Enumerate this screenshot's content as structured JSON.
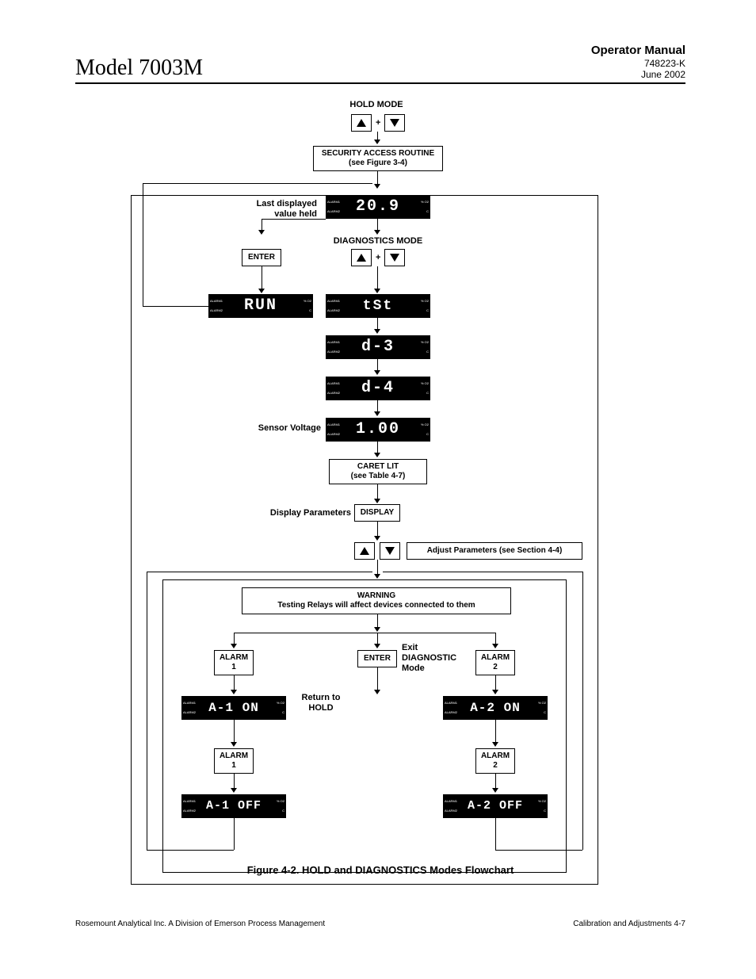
{
  "header": {
    "model": "Model 7003M",
    "manual": "Operator Manual",
    "docnum": "748223-K",
    "date": "June 2002"
  },
  "labels": {
    "hold_mode": "HOLD MODE",
    "security": "SECURITY ACCESS ROUTINE\n(see Figure 3-4)",
    "last_value": "Last displayed\nvalue held",
    "diagnostics_mode": "DIAGNOSTICS MODE",
    "enter": "ENTER",
    "sensor_voltage": "Sensor Voltage",
    "caret_lit": "CARET LIT\n(see Table 4-7)",
    "display_params": "Display Parameters",
    "display": "DISPLAY",
    "adjust_params": "Adjust Parameters (see Section 4-4)",
    "warning": "WARNING\nTesting Relays will affect devices connected to them",
    "alarm1": "ALARM\n1",
    "alarm2": "ALARM\n2",
    "exit_diag": "Exit\nDIAGNOSTIC\nMode",
    "return_hold": "Return to\nHOLD",
    "plus": "+"
  },
  "lcd": {
    "side_left_1": "ALARM1",
    "side_left_2": "ALARM2",
    "side_right_1": "% O2",
    "side_right_2": "C",
    "v_209": "20.9",
    "v_run": "RUN",
    "v_tst": "tSt",
    "v_d3": "d-3",
    "v_d4": "d-4",
    "v_100": "1.00",
    "v_a1on": "A-1 ON",
    "v_a1off": "A-1 OFF",
    "v_a2on": "A-2 ON",
    "v_a2off": "A-2 OFF"
  },
  "caption": "Figure 4-2.  HOLD and DIAGNOSTICS Modes Flowchart",
  "footer": {
    "left": "Rosemount Analytical Inc.    A Division of Emerson Process Management",
    "right": "Calibration and Adjustments    4-7"
  }
}
